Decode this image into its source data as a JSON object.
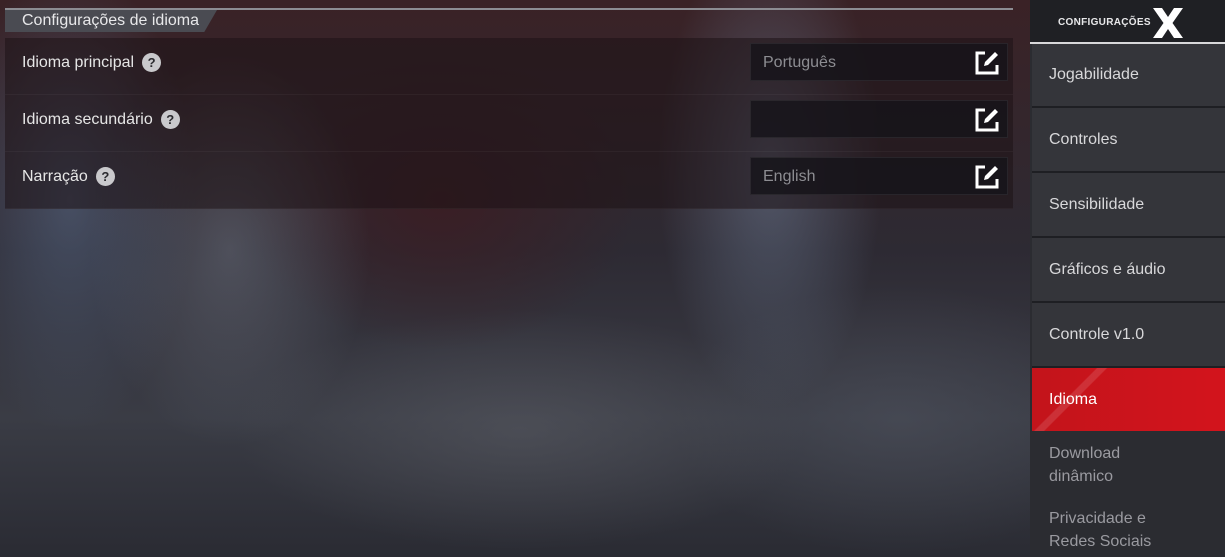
{
  "section": {
    "title": "Configurações de idioma"
  },
  "rows": [
    {
      "label": "Idioma principal",
      "value": "Português"
    },
    {
      "label": "Idioma secundário",
      "value": ""
    },
    {
      "label": "Narração",
      "value": "English"
    }
  ],
  "sidebar": {
    "title": "CONFIGURAÇÕES",
    "items": [
      {
        "label": "Jogabilidade"
      },
      {
        "label": "Controles"
      },
      {
        "label": "Sensibilidade"
      },
      {
        "label": "Gráficos e áudio"
      },
      {
        "label": "Controle v1.0"
      },
      {
        "label": "Idioma",
        "active": true
      },
      {
        "label_line1": "Download",
        "label_line2": "dinâmico"
      },
      {
        "label_line1": "Privacidade e",
        "label_line2": "Redes Sociais"
      }
    ]
  },
  "colors": {
    "accent": "#d3141c",
    "sidebar_bg": "#2b2c31"
  },
  "icons": {
    "help": "question-circle-icon",
    "edit": "pencil-square-icon",
    "close": "x-close-icon"
  }
}
